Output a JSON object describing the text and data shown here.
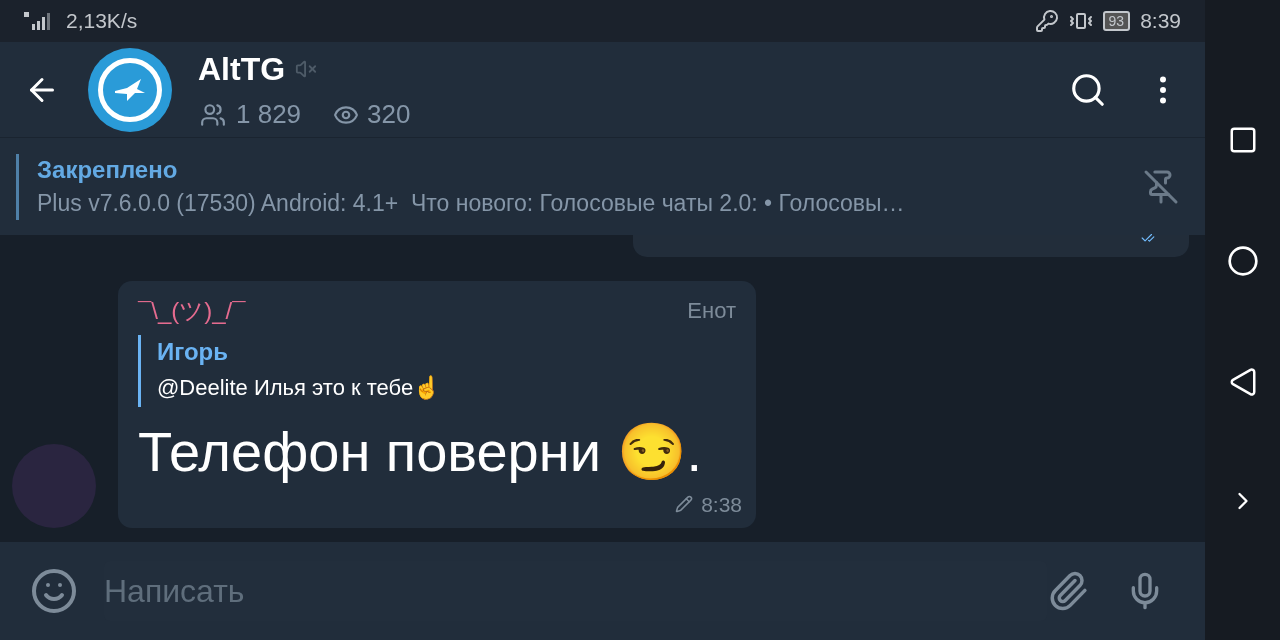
{
  "status_bar": {
    "speed": "2,13K/s",
    "battery": "93",
    "time": "8:39"
  },
  "header": {
    "title": "AltTG",
    "muted": true,
    "members": "1 829",
    "views": "320"
  },
  "pinned": {
    "label": "Закреплено",
    "text": "Plus v7.6.0.0 (17530) Android: 4.1+  Что нового: Голосовые чаты 2.0: • Голосовы…"
  },
  "messages": [
    {
      "kind": "outgoing",
      "read": true
    },
    {
      "kind": "incoming",
      "sender": "¯\\_(ツ)_/¯",
      "badge": "Енот",
      "reply": {
        "name": "Игорь",
        "text": "@Deelite Илья это к тебе☝"
      },
      "text": "Телефон поверни 😏.",
      "edited": true,
      "time": "8:38"
    }
  ],
  "composer": {
    "placeholder": "Написать"
  }
}
